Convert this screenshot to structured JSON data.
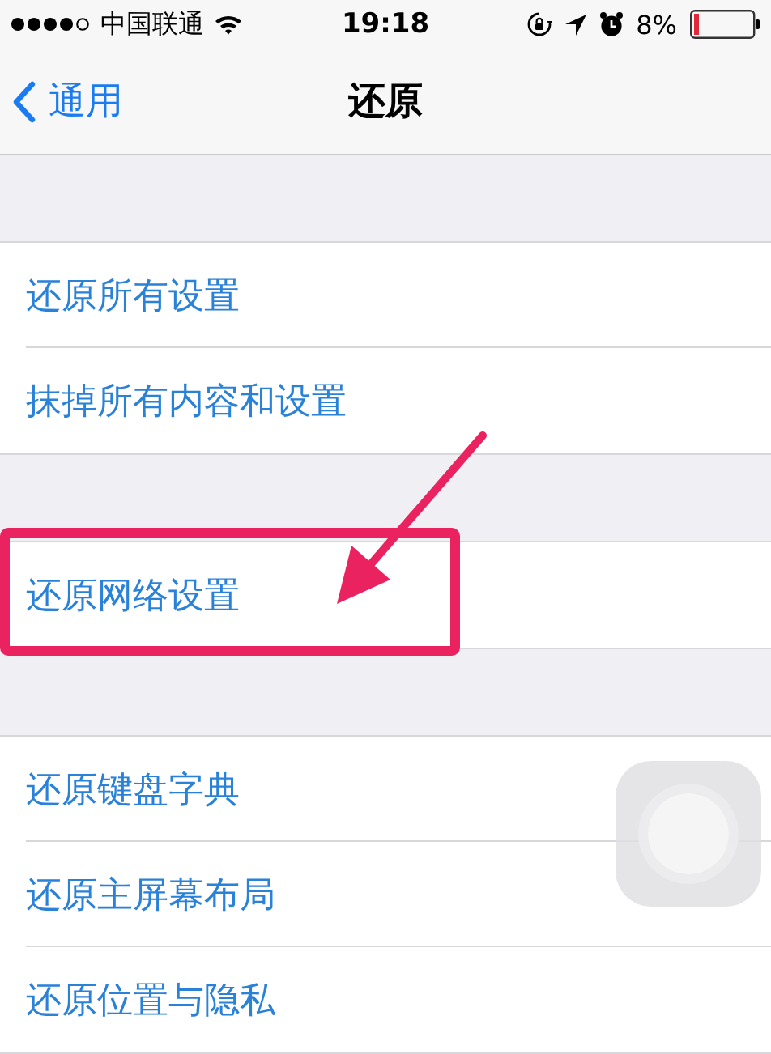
{
  "status_bar": {
    "carrier": "中国联通",
    "time": "19:18",
    "battery": "8%"
  },
  "nav_bar": {
    "back_label": "通用",
    "title": "还原"
  },
  "groups": [
    {
      "items": [
        {
          "label": "还原所有设置",
          "annotated": false
        },
        {
          "label": "抹掉所有内容和设置",
          "annotated": false
        }
      ]
    },
    {
      "items": [
        {
          "label": "还原网络设置",
          "annotated": true
        }
      ]
    },
    {
      "items": [
        {
          "label": "还原键盘字典",
          "annotated": false
        },
        {
          "label": "还原主屏幕布局",
          "annotated": false
        },
        {
          "label": "还原位置与隐私",
          "annotated": false
        }
      ]
    }
  ]
}
